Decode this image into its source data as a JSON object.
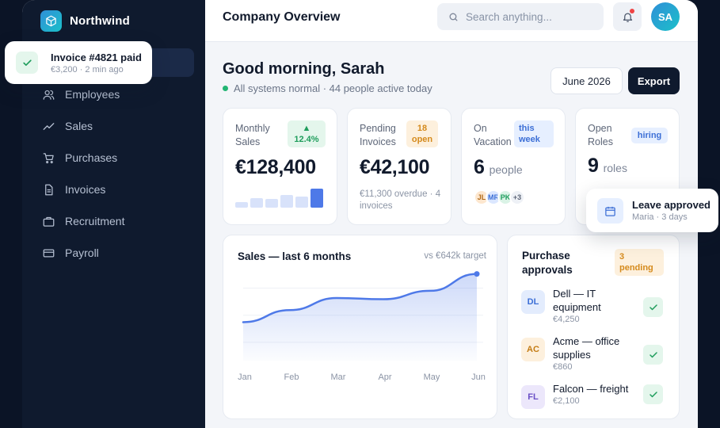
{
  "brand": {
    "name": "Northwind",
    "icon": "cube-icon"
  },
  "nav": [
    {
      "label": "Employees",
      "icon": "users-icon"
    },
    {
      "label": "Sales",
      "icon": "trend-icon"
    },
    {
      "label": "Purchases",
      "icon": "cart-icon"
    },
    {
      "label": "Invoices",
      "icon": "document-icon"
    },
    {
      "label": "Recruitment",
      "icon": "briefcase-icon"
    },
    {
      "label": "Payroll",
      "icon": "card-icon"
    }
  ],
  "topbar": {
    "title": "Company Overview",
    "search_placeholder": "Search anything...",
    "avatar_initials": "SA"
  },
  "greeting": {
    "title": "Good morning, Sarah",
    "status": "All systems normal · 44 people active today"
  },
  "actions": {
    "month": "June 2026",
    "export": "Export"
  },
  "kpis": {
    "sales": {
      "label": "Monthly Sales",
      "badge": "▲ 12.4%",
      "value": "€128,400",
      "bars": [
        0.28,
        0.45,
        0.42,
        0.62,
        0.55,
        0.92
      ]
    },
    "invoices": {
      "label": "Pending Invoices",
      "badge": "18 open",
      "value": "€42,100",
      "sub": "€11,300 overdue · 4 invoices"
    },
    "vacation": {
      "label": "On Vacation",
      "badge": "this week",
      "value": "6",
      "unit": "people",
      "avatars": [
        "JL",
        "MR",
        "PK"
      ],
      "more": "+3"
    },
    "roles": {
      "label": "Open Roles",
      "badge": "hiring",
      "value": "9",
      "unit": "roles"
    }
  },
  "sales_chart": {
    "title": "Sales — last 6 months",
    "note": "vs €642k target"
  },
  "chart_data": {
    "type": "area",
    "title": "Sales — last 6 months",
    "categories": [
      "Jan",
      "Feb",
      "Mar",
      "Apr",
      "May",
      "Jun"
    ],
    "values": [
      88,
      98,
      108,
      107,
      114,
      128
    ],
    "ylim": [
      60,
      135
    ],
    "grid": true
  },
  "approvals": {
    "title": "Purchase approvals",
    "badge": "3 pending",
    "items": [
      {
        "initials": "DL",
        "name": "Dell — IT equipment",
        "amount": "€4,250"
      },
      {
        "initials": "AC",
        "name": "Acme — office supplies",
        "amount": "€860"
      },
      {
        "initials": "FL",
        "name": "Falcon — freight",
        "amount": "€2,100"
      }
    ]
  },
  "toasts": {
    "invoice": {
      "title": "Invoice #4821 paid",
      "sub": "€3,200 · 2 min ago"
    },
    "leave": {
      "title": "Leave approved",
      "sub": "Maria · 3 days"
    }
  },
  "colors": {
    "accent": "#4e79e8",
    "sidebar": "#0f1a2e",
    "success": "#22b573"
  }
}
